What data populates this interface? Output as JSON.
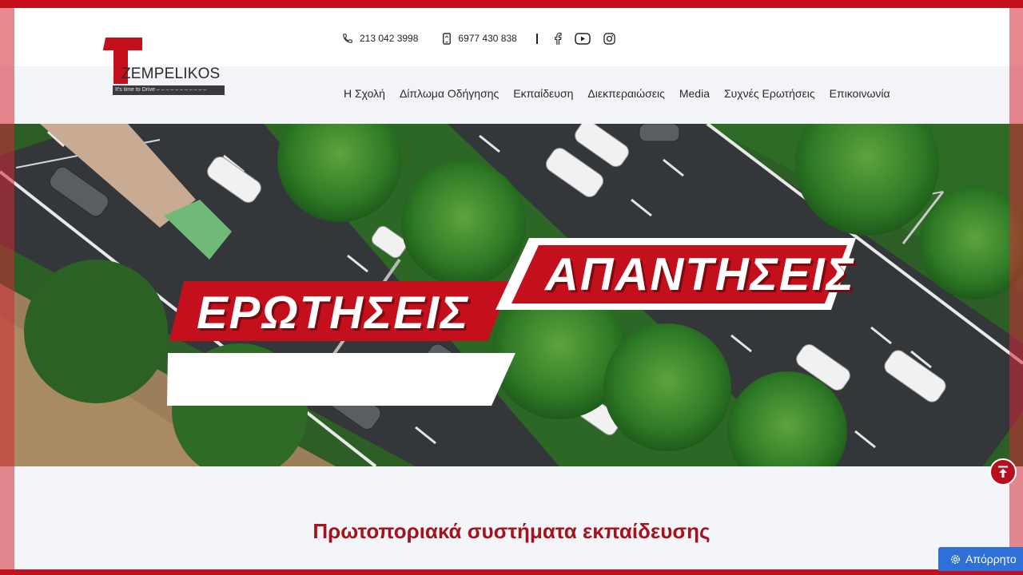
{
  "brand": {
    "name": "ZEMPELIKOS",
    "tagline": "It's time to Drive",
    "primary_color": "#c4101c",
    "logo_icon": "stylized-T-mark"
  },
  "contacts": {
    "phone": "213 042 3998",
    "mobile": "6977 430 838",
    "phone_icon": "phone-icon",
    "mobile_icon": "mobile-phone-icon"
  },
  "social": [
    {
      "name": "facebook-icon"
    },
    {
      "name": "youtube-icon"
    },
    {
      "name": "instagram-icon"
    }
  ],
  "nav": {
    "items": [
      {
        "label": "Η Σχολή"
      },
      {
        "label": "Δίπλωμα Οδήγησης"
      },
      {
        "label": "Εκπαίδευση"
      },
      {
        "label": "Διεκπεραιώσεις"
      },
      {
        "label": "Media"
      },
      {
        "label": "Συχνές Ερωτήσεις"
      },
      {
        "label": "Επικοινωνία"
      }
    ]
  },
  "hero": {
    "title_left": "ΕΡΩΤΗΣΕΙΣ",
    "title_right": "ΑΠΑΝΤΗΣΕΙΣ"
  },
  "content": {
    "heading": "Πρωτοποριακά συστήματα εκπαίδευσης"
  },
  "widgets": {
    "scroll_top_icon": "arrow-up-icon",
    "cookie_label": "Απόρρητο",
    "cookie_icon": "gear-icon"
  }
}
